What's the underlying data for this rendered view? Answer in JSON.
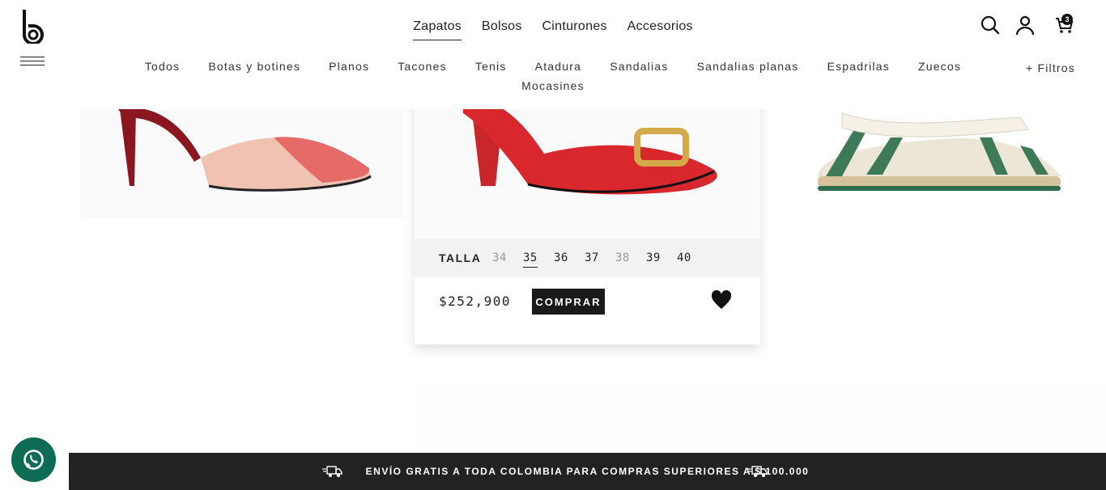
{
  "header": {
    "logo_icon": "brand-logo-b",
    "menu_icon": "hamburger-icon",
    "main_nav": [
      {
        "label": "Zapatos",
        "active": true
      },
      {
        "label": "Bolsos",
        "active": false
      },
      {
        "label": "Cinturones",
        "active": false
      },
      {
        "label": "Accesorios",
        "active": false
      }
    ],
    "icons": {
      "search": "search-icon",
      "account": "user-icon",
      "cart": "cart-icon"
    },
    "cart_count": "3"
  },
  "categories": [
    "Todos",
    "Botas y botines",
    "Planos",
    "Tacones",
    "Tenis",
    "Atadura",
    "Sandalias",
    "Sandalias planas",
    "Espadrilas",
    "Zuecos",
    "Mocasines"
  ],
  "filters_label": "+ Filtros",
  "card": {
    "size_label": "TALLA",
    "sizes": [
      {
        "label": "34",
        "available": false
      },
      {
        "label": "35",
        "available": true,
        "selected": true
      },
      {
        "label": "36",
        "available": true
      },
      {
        "label": "37",
        "available": true
      },
      {
        "label": "38",
        "available": false
      },
      {
        "label": "39",
        "available": true
      },
      {
        "label": "40",
        "available": true
      }
    ],
    "price": "$252,900",
    "buy_label": "COMPRAR",
    "wishlist_icon": "heart-icon"
  },
  "banner": {
    "text": "ENVÍO GRATIS A TODA COLOMBIA PARA COMPRAS SUPERIORES A $ 100.000",
    "icon": "truck-icon"
  },
  "whatsapp_icon": "whatsapp-icon",
  "colors": {
    "banner_bg": "#222222",
    "whatsapp": "#0e6b54",
    "accent": "#1a1a1a"
  }
}
